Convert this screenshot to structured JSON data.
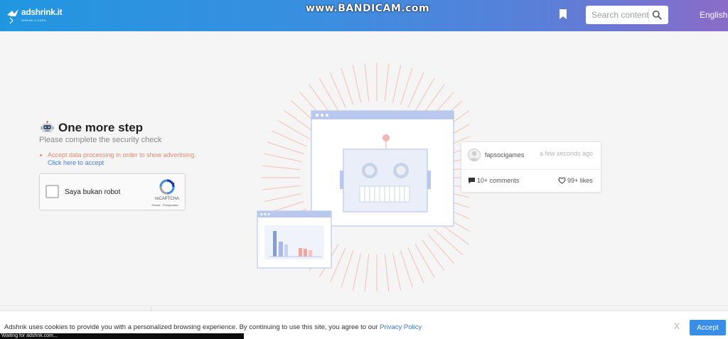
{
  "header": {
    "logo_text": "adshrink.it",
    "logo_tagline": "SHRINK & EARN",
    "watermark": "www.BANDICAM.com",
    "search_placeholder": "Search content",
    "language": "English"
  },
  "verify": {
    "title": "One more step",
    "subtitle": "Please complete the security check",
    "warning": "Accept data processing in order to show advertising.",
    "accept_link": "Click here to accept"
  },
  "captcha": {
    "label": "Saya bukan robot",
    "brand": "reCAPTCHA",
    "links": "Privasi - Persyaratan"
  },
  "card": {
    "username": "fapsocigames",
    "time": "a few seconds ago",
    "comments": "10+ comments",
    "likes": "99+ likes"
  },
  "cookie": {
    "text": "Adshnk uses cookies to provide you with a personalized browsing experience. By continuing to use this site, you agree to our ",
    "policy_link": "Privacy Policy",
    "dismiss": "X",
    "accept_label": "Accept"
  },
  "status_bar": "Waiting for adshnk.com...",
  "colors": {
    "header_start": "#2196e0",
    "header_end": "#8a6cc8",
    "warning": "#e88874",
    "link": "#4a7fd0",
    "accept_button": "#3a8ee6"
  }
}
